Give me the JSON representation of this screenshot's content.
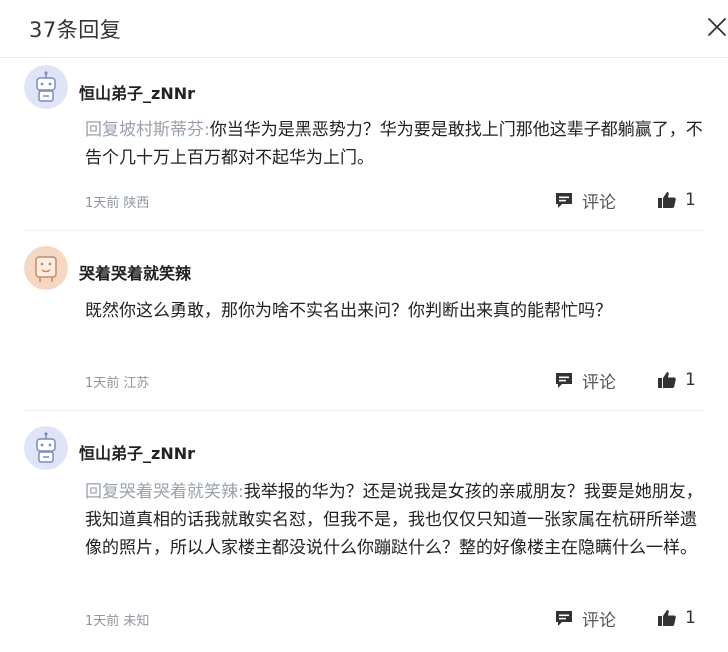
{
  "header": {
    "title": "37条回复",
    "close_icon": "close-icon"
  },
  "colors": {
    "avatar_blue": "#dfe4f7",
    "avatar_peach": "#f6d7c4",
    "muted": "#9aa2ad"
  },
  "comments": [
    {
      "username": "恒山弟子_zNNr",
      "reply_prefix": "回复坡村斯蒂芬:",
      "text": "你当华为是黑恶势力？华为要是敢找上门那他这辈子都躺赢了，不告个几十万上百万都对不起华为上门。",
      "meta": "1天前 陕西",
      "reply_label": "评论",
      "likes": "1"
    },
    {
      "username": "哭着哭着就笑辣",
      "reply_prefix": "",
      "text": "既然你这么勇敢，那你为啥不实名出来问？你判断出来真的能帮忙吗？",
      "meta": "1天前 江苏",
      "reply_label": "评论",
      "likes": "1"
    },
    {
      "username": "恒山弟子_zNNr",
      "reply_prefix": "回复哭着哭着就笑辣:",
      "text": "我举报的华为？还是说我是女孩的亲戚朋友？我要是她朋友，我知道真相的话我就敢实名怼，但我不是，我也仅仅只知道一张家属在杭研所举遗像的照片，所以人家楼主都没说什么你蹦跶什么？整的好像楼主在隐瞒什么一样。",
      "meta": "1天前 未知",
      "reply_label": "评论",
      "likes": "1"
    }
  ]
}
